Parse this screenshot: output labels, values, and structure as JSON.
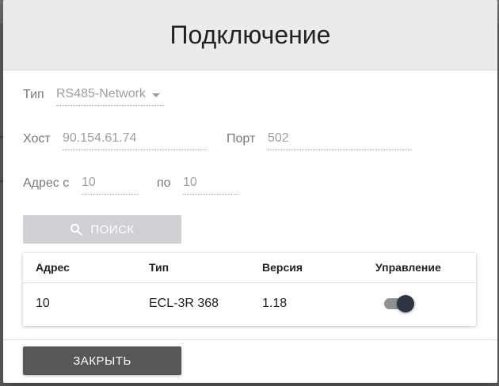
{
  "dialog": {
    "title": "Подключение"
  },
  "form": {
    "type_label": "Тип",
    "type_value": "RS485-Network",
    "host_label": "Хост",
    "host_value": "90.154.61.74",
    "port_label": "Порт",
    "port_value": "502",
    "address_from_label": "Адрес с",
    "address_from_value": "10",
    "address_to_label": "по",
    "address_to_value": "10"
  },
  "search_button": {
    "label": "ПОИСК",
    "icon": "search-icon"
  },
  "table": {
    "columns": [
      "Адрес",
      "Тип",
      "Версия",
      "Управление"
    ],
    "rows": [
      {
        "address": "10",
        "type": "ECL-3R 368",
        "version": "1.18",
        "control_on": true
      }
    ]
  },
  "close_button": {
    "label": "ЗАКРЫТЬ"
  },
  "colors": {
    "header_bg": "#ebebeb",
    "search_button_bg": "#d0d1d6",
    "close_button_bg": "#575757",
    "toggle_knob": "#2f3443",
    "toggle_track": "#8f9198"
  }
}
